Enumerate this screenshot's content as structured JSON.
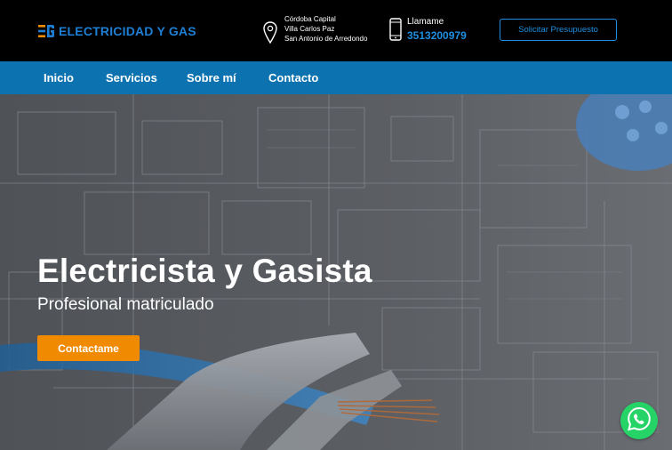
{
  "header": {
    "brand": "ELECTRICIDAD Y GAS",
    "location_lines": [
      "Córdoba Capital",
      "Villa Carlos Paz",
      "San Antonio de Arredondo"
    ],
    "phone_label": "Llamame",
    "phone_number": "3513200979",
    "quote_button": "Solicitar Presupuesto"
  },
  "nav": {
    "items": [
      "Inicio",
      "Servicios",
      "Sobre mí",
      "Contacto"
    ]
  },
  "hero": {
    "title": "Electricista y Gasista",
    "subtitle": "Profesional matriculado",
    "cta": "Contactame"
  },
  "icons": {
    "logo": "logo-mark-icon",
    "location": "map-pin-icon",
    "phone": "smartphone-icon",
    "whatsapp": "whatsapp-icon"
  },
  "colors": {
    "brand_blue": "#1e7fd4",
    "nav_blue": "#0d73b0",
    "cta_orange": "#f08a00",
    "whatsapp_green": "#25d366"
  }
}
